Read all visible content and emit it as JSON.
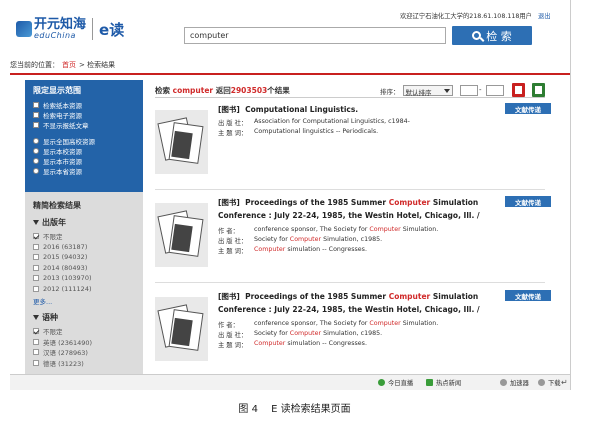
{
  "header": {
    "logo_cn": "开元知海",
    "logo_en": "eduChina",
    "logo_product": "e读",
    "welcome": "欢迎辽宁石油化工大学的218.61.108.118用户",
    "exit": "退出",
    "search_value": "computer",
    "search_button": "检 索"
  },
  "breadcrumb": {
    "label": "您当前的位置：",
    "home": "首页",
    "sep": ">",
    "current": "检索结果"
  },
  "sidebar": {
    "scope_title": "限定显示范围",
    "scope_options": [
      "检索纸本资源",
      "检索电子资源",
      "不显示报纸文章"
    ],
    "source_options": [
      "显示全国高校资源",
      "显示本校资源",
      "显示本市资源",
      "显示本省资源"
    ],
    "refine_title": "精简检索结果",
    "year_facet": "出版年",
    "year_items": [
      {
        "label": "不限定",
        "checked": true
      },
      {
        "label": "2016 (63187)",
        "checked": false
      },
      {
        "label": "2015 (94032)",
        "checked": false
      },
      {
        "label": "2014 (80493)",
        "checked": false
      },
      {
        "label": "2013 (103970)",
        "checked": false
      },
      {
        "label": "2012 (111124)",
        "checked": false
      }
    ],
    "more": "更多...",
    "lang_facet": "语种",
    "lang_items": [
      {
        "label": "不限定",
        "checked": true
      },
      {
        "label": "英语 (2361490)",
        "checked": false
      },
      {
        "label": "汉语 (278963)",
        "checked": false
      },
      {
        "label": "德语 (31223)",
        "checked": false
      }
    ]
  },
  "results": {
    "prefix": "检索",
    "keyword": "computer",
    "returned": "返回",
    "count": "2903503",
    "suffix": "个结果",
    "sort_label": "排序：",
    "sort_value": "默认排序",
    "page_sep": "-",
    "items": [
      {
        "type": "[图书]",
        "title_pre": "Computational Linguistics.",
        "title_hl": "",
        "title_post": "",
        "btn": "文献传递",
        "meta": [
          {
            "label": "出 版 社：",
            "pre": "Association for Computational Linguistics, c1984-",
            "hl": "",
            "post": ""
          },
          {
            "label": "主 题 词：",
            "pre": "Computational linguistics -- Periodicals.",
            "hl": "",
            "post": ""
          }
        ]
      },
      {
        "type": "[图书]",
        "title_pre": "Proceedings of the 1985 Summer ",
        "title_hl": "Computer",
        "title_post": " Simulation Conference : July 22-24, 1985, the Westin Hotel, Chicago, Ill. /",
        "btn": "文献传递",
        "meta": [
          {
            "label": "作 者：",
            "pre": "conference sponsor, The Society for ",
            "hl": "Computer",
            "post": " Simulation."
          },
          {
            "label": "出 版 社：",
            "pre": "Society for ",
            "hl": "Computer",
            "post": " Simulation, c1985."
          },
          {
            "label": "主 题 词：",
            "pre": "",
            "hl": "Computer",
            "post": " simulation -- Congresses."
          }
        ]
      },
      {
        "type": "[图书]",
        "title_pre": "Proceedings of the 1985 Summer ",
        "title_hl": "Computer",
        "title_post": " Simulation Conference : July 22-24, 1985, the Westin Hotel, Chicago, Ill. /",
        "btn": "文献传递",
        "meta": [
          {
            "label": "作 者：",
            "pre": "conference sponsor, The Society for ",
            "hl": "Computer",
            "post": " Simulation."
          },
          {
            "label": "出 版 社：",
            "pre": "Society for ",
            "hl": "Computer",
            "post": " Simulation, c1985."
          },
          {
            "label": "主 题 词：",
            "pre": "",
            "hl": "Computer",
            "post": " simulation -- Congresses."
          }
        ]
      }
    ]
  },
  "statusbar": {
    "today": "今日直播",
    "hot": "热点新闻",
    "accel": "加速器",
    "download": "下载"
  },
  "caption": "图 4　 E 读检索结果页面",
  "colors": {
    "brand_blue": "#2d6fb4",
    "sidebar_blue": "#2363a8",
    "highlight_red": "#d02a2a",
    "rule_red": "#c8201f"
  }
}
